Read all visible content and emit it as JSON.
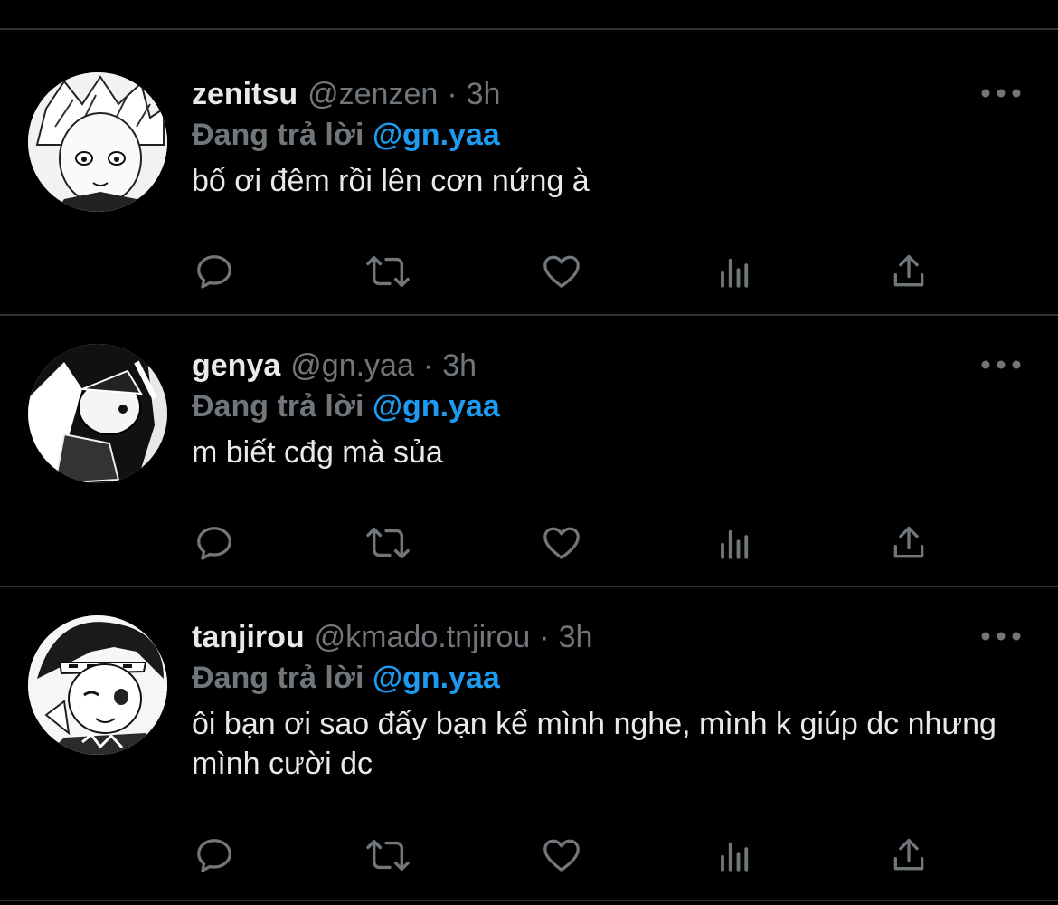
{
  "reply_prefix": "Đang trả lời",
  "tweets": [
    {
      "name": "zenitsu",
      "handle": "@zenzen",
      "separator": "·",
      "time": "3h",
      "mention": "@gn.yaa",
      "text": "bố ơi đêm rồi lên cơn nứng à"
    },
    {
      "name": "genya",
      "handle": "@gn.yaa",
      "separator": "·",
      "time": "3h",
      "mention": "@gn.yaa",
      "text": "m biết cđg mà sủa"
    },
    {
      "name": "tanjirou",
      "handle": "@kmado.tnjirou",
      "separator": "·",
      "time": "3h",
      "mention": "@gn.yaa",
      "text": "ôi bạn ơi sao đấy bạn kể mình nghe, mình k giúp dc nhưng mình cười dc"
    }
  ],
  "icons": {
    "more": "more-icon",
    "reply": "reply-icon",
    "retweet": "retweet-icon",
    "like": "heart-icon",
    "analytics": "analytics-icon",
    "share": "share-icon"
  },
  "colors": {
    "background": "#000000",
    "text": "#e7e9ea",
    "muted": "#71767b",
    "link": "#1d9bf0",
    "divider": "#2f3336"
  }
}
